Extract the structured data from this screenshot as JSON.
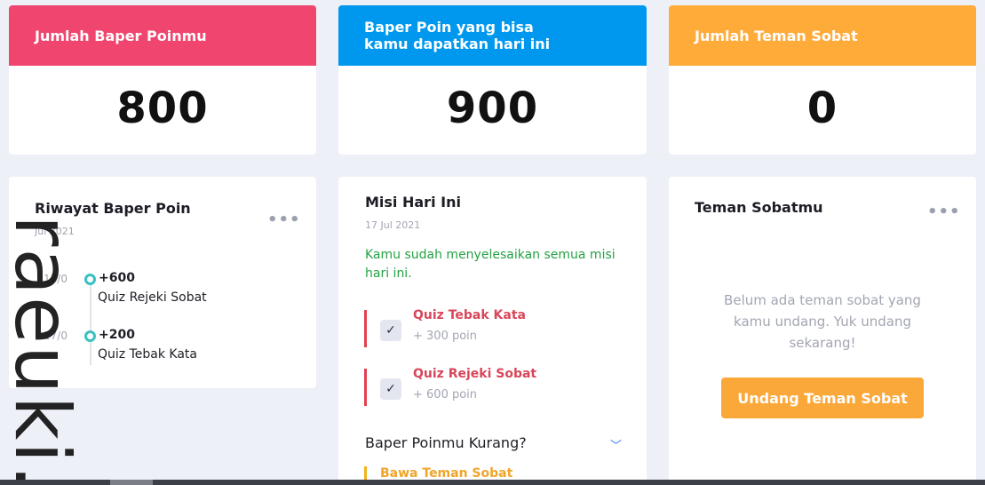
{
  "stats": [
    {
      "label": "Jumlah Baper Poinmu",
      "value": "800",
      "color": "#f0456e"
    },
    {
      "label_line1": "Baper Poin yang bisa",
      "label_line2": "kamu dapatkan hari ini",
      "value": "900",
      "color": "#0098ee"
    },
    {
      "label": "Jumlah Teman Sobat",
      "value": "0",
      "color": "#ffab3a"
    }
  ],
  "history": {
    "title": "Riwayat Baper Poin",
    "date_partial": "Jul 2021",
    "items": [
      {
        "date": "17/0",
        "points": "+600",
        "name": "Quiz Rejeki Sobat"
      },
      {
        "date": "17/0",
        "points": "+200",
        "name": "Quiz Tebak Kata"
      }
    ]
  },
  "missions": {
    "title": "Misi Hari Ini",
    "date": "17 Jul 2021",
    "done_message": "Kamu sudah menyelesaikan semua misi hari ini.",
    "items": [
      {
        "name": "Quiz Tebak Kata",
        "points": "+ 300 poin"
      },
      {
        "name": "Quiz Rejeki Sobat",
        "points": "+ 600 poin"
      }
    ],
    "less_title": "Baper Poinmu Kurang?",
    "bring_friend": "Bawa Teman Sobat"
  },
  "friends": {
    "title": "Teman Sobatmu",
    "empty_message": "Belum ada teman sobat yang kamu undang. Yuk undang sekarang!",
    "invite_label": "Undang Teman Sobat"
  },
  "icons": {
    "more": "more-dots-icon",
    "check": "check-icon",
    "chevron": "chevron-down-icon"
  },
  "watermark": "raeuki."
}
